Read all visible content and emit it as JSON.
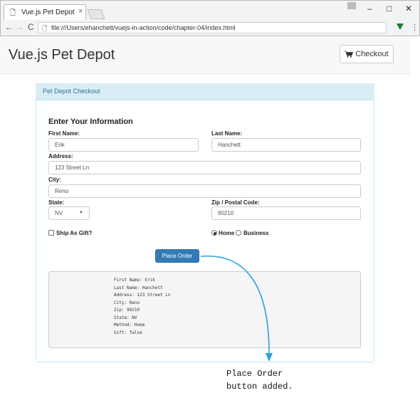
{
  "browser": {
    "tab_title": "Vue.js Pet Depot",
    "tab_close": "×",
    "url": "file:///Users/ehanchett/vuejs-in-action/code/chapter-04/index.html",
    "window_controls": [
      "–",
      "□",
      "✕"
    ],
    "nav": {
      "back": "←",
      "forward": "→",
      "reload": "C"
    }
  },
  "header": {
    "title": "Vue.js Pet Depot",
    "checkout_label": "Checkout"
  },
  "panel": {
    "heading": "Pet Depot Checkout"
  },
  "form": {
    "section_title": "Enter Your Information",
    "first_name": {
      "label": "First Name:",
      "value": "Erik"
    },
    "last_name": {
      "label": "Last Name:",
      "value": "Hanchett"
    },
    "address": {
      "label": "Address:",
      "value": "123 Street Ln"
    },
    "city": {
      "label": "City:",
      "value": "Reno"
    },
    "state": {
      "label": "State:",
      "value": "NV"
    },
    "zip": {
      "label": "Zip / Postal Code:",
      "value": "90210"
    },
    "gift_label": "Ship As Gift?",
    "method_home": "Home",
    "method_business": "Business",
    "place_order": "Place Order"
  },
  "summary": [
    "First Name: Erik",
    "Last Name: Hanchett",
    "Address: 123 Street Ln",
    "City: Reno",
    "Zip: 90210",
    "State: NV",
    "Method: Home",
    "Gift: false"
  ],
  "annotation": {
    "line1": "Place Order",
    "line2": "button added."
  },
  "colors": {
    "annotation_arrow": "#29a3d9",
    "primary_button": "#337ab7",
    "panel_heading": "#d9edf7"
  }
}
